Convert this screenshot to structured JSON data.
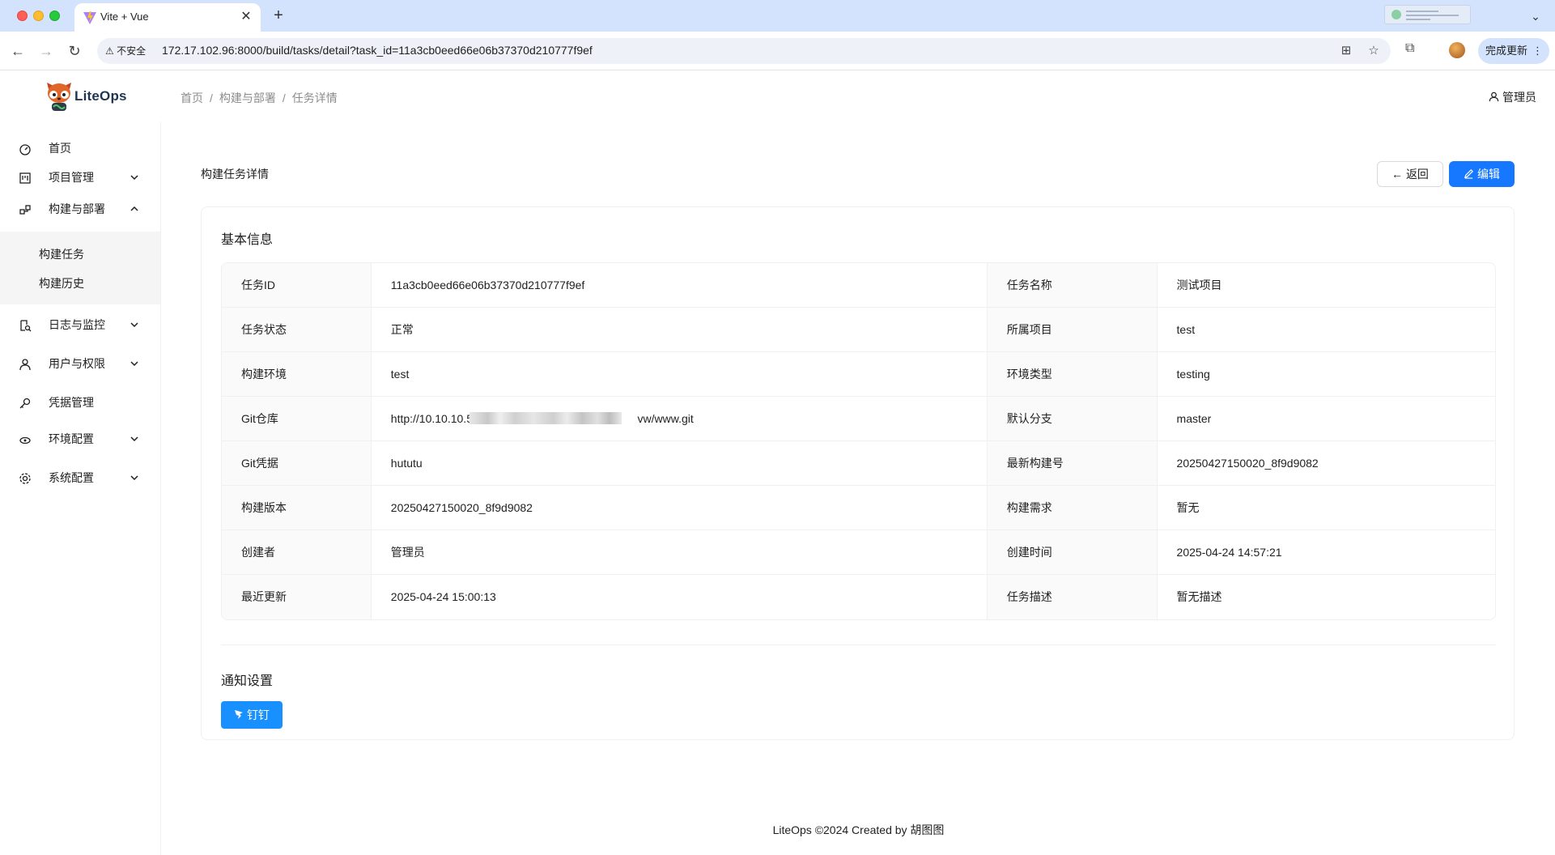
{
  "browser": {
    "tab_title": "Vite + Vue",
    "insecure_label": "不安全",
    "url": "172.17.102.96:8000/build/tasks/detail?task_id=11a3cb0eed66e06b37370d210777f9ef",
    "update_label": "完成更新",
    "icons": [
      "back-arrow-icon",
      "forward-arrow-icon",
      "reload-icon",
      "translate-icon",
      "star-icon",
      "extensions-icon",
      "kebab-icon"
    ]
  },
  "app": {
    "logo_text": "LiteOps",
    "breadcrumb": [
      "首页",
      "构建与部署",
      "任务详情"
    ],
    "admin_label": "管理员"
  },
  "sidebar": {
    "items": [
      {
        "label": "首页",
        "icon": "dashboard-icon"
      },
      {
        "label": "项目管理",
        "icon": "project-icon",
        "expandable": true
      },
      {
        "label": "构建与部署",
        "icon": "build-icon",
        "expandable": true,
        "expanded": true,
        "children": [
          "构建任务",
          "构建历史"
        ]
      },
      {
        "label": "日志与监控",
        "icon": "log-search-icon",
        "expandable": true
      },
      {
        "label": "用户与权限",
        "icon": "user-icon",
        "expandable": true
      },
      {
        "label": "凭据管理",
        "icon": "key-icon"
      },
      {
        "label": "环境配置",
        "icon": "cloud-icon",
        "expandable": true
      },
      {
        "label": "系统配置",
        "icon": "gear-icon",
        "expandable": true
      }
    ]
  },
  "page": {
    "title": "构建任务详情",
    "back_label": "返回",
    "edit_label": "编辑",
    "basic_info_title": "基本信息",
    "notify_title": "通知设置",
    "notify_button": "钉钉",
    "rows": [
      {
        "l1": "任务ID",
        "v1": "11a3cb0eed66e06b37370d210777f9ef",
        "l2": "任务名称",
        "v2": "测试项目"
      },
      {
        "l1": "任务状态",
        "v1": "正常",
        "l2": "所属项目",
        "v2": "test"
      },
      {
        "l1": "构建环境",
        "v1": "test",
        "l2": "环境类型",
        "v2": "testing"
      },
      {
        "l1": "Git仓库",
        "v1a": "http://10.10.10.50/f",
        "v1b": "vw/www.git",
        "l2": "默认分支",
        "v2": "master"
      },
      {
        "l1": "Git凭据",
        "v1": "hututu",
        "l2": "最新构建号",
        "v2": "20250427150020_8f9d9082"
      },
      {
        "l1": "构建版本",
        "v1": "20250427150020_8f9d9082",
        "l2": "构建需求",
        "v2": "暂无"
      },
      {
        "l1": "创建者",
        "v1": "管理员",
        "l2": "创建时间",
        "v2": "2025-04-24 14:57:21"
      },
      {
        "l1": "最近更新",
        "v1": "2025-04-24 15:00:13",
        "l2": "任务描述",
        "v2": "暂无描述"
      }
    ]
  },
  "footer": "LiteOps ©2024 Created by 胡图图"
}
